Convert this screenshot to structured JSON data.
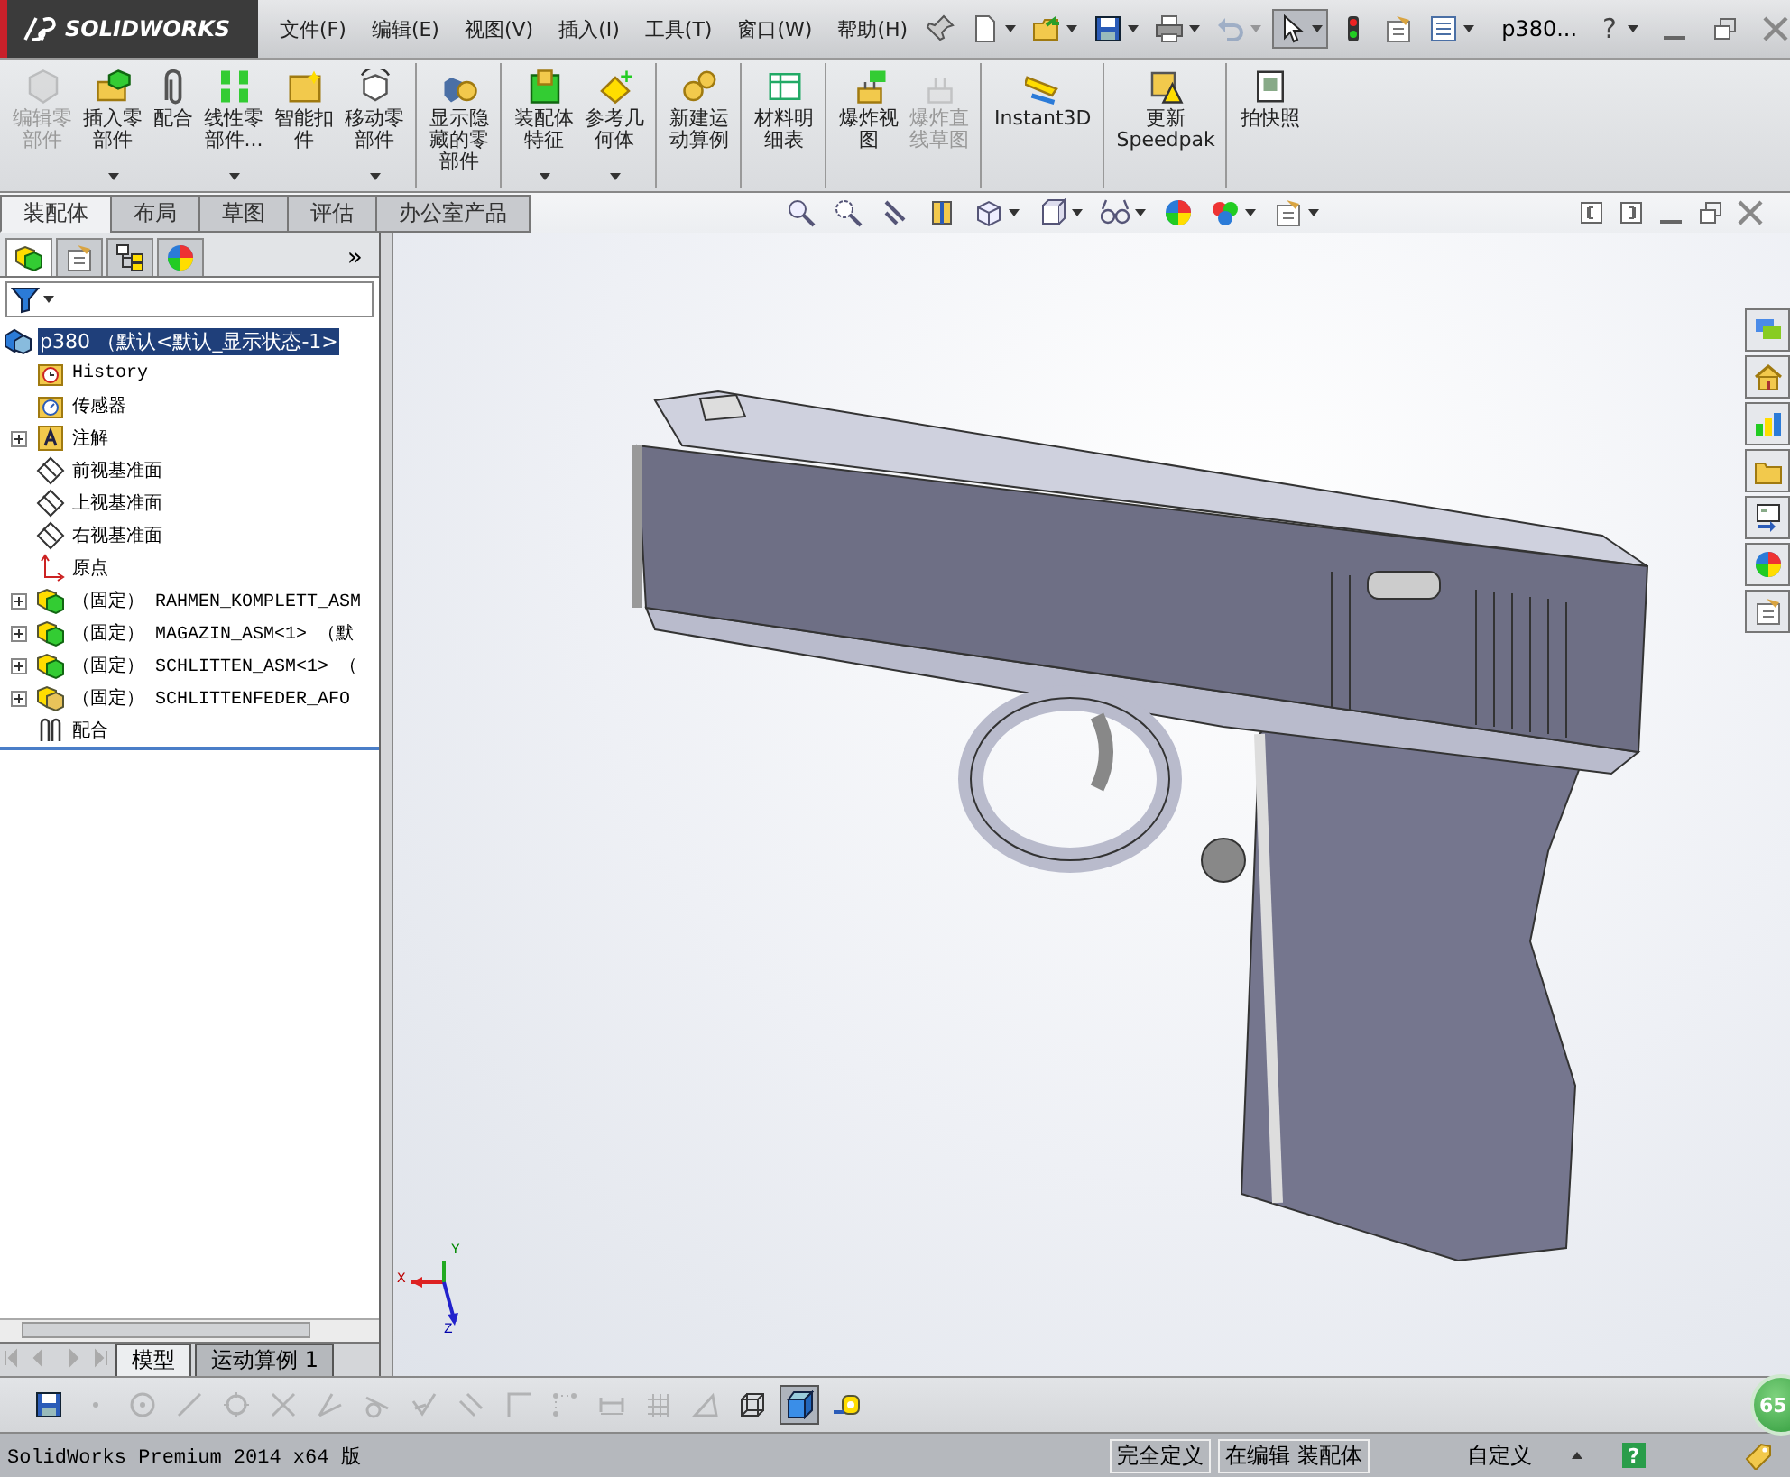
{
  "title_bar": {
    "logo": "SOLIDWORKS",
    "menus": [
      "文件(F)",
      "编辑(E)",
      "视图(V)",
      "插入(I)",
      "工具(T)",
      "窗口(W)",
      "帮助(H)"
    ],
    "document": "p380...",
    "help": "?"
  },
  "quick_toolbar": [
    {
      "kind": "new",
      "disabled": false,
      "selected": false,
      "dropdown": true
    },
    {
      "kind": "open",
      "disabled": false,
      "selected": false,
      "dropdown": true
    },
    {
      "kind": "save",
      "disabled": false,
      "selected": false,
      "dropdown": true
    },
    {
      "kind": "print",
      "disabled": false,
      "selected": false,
      "dropdown": true
    },
    {
      "kind": "undo",
      "disabled": true,
      "selected": false,
      "dropdown": true
    },
    {
      "kind": "select",
      "disabled": false,
      "selected": true,
      "dropdown": true
    },
    {
      "kind": "rebuild",
      "disabled": false,
      "selected": false,
      "dropdown": false
    },
    {
      "kind": "options",
      "disabled": false,
      "selected": false,
      "dropdown": false
    },
    {
      "kind": "list",
      "disabled": false,
      "selected": false,
      "dropdown": true
    }
  ],
  "ribbon": [
    {
      "kind": "edit-part",
      "lines": [
        "编辑零",
        "部件"
      ],
      "disabled": true,
      "dropdown": false,
      "separator_after": false
    },
    {
      "kind": "insert",
      "lines": [
        "插入零",
        "部件"
      ],
      "disabled": false,
      "dropdown": true,
      "separator_after": false
    },
    {
      "kind": "mate",
      "lines": [
        "配合"
      ],
      "disabled": false,
      "dropdown": false,
      "separator_after": false
    },
    {
      "kind": "pattern",
      "lines": [
        "线性零",
        "部件..."
      ],
      "disabled": false,
      "dropdown": true,
      "separator_after": false
    },
    {
      "kind": "fastener",
      "lines": [
        "智能扣",
        "件"
      ],
      "disabled": false,
      "dropdown": false,
      "separator_after": false
    },
    {
      "kind": "move",
      "lines": [
        "移动零",
        "部件"
      ],
      "disabled": false,
      "dropdown": true,
      "separator_after": true
    },
    {
      "kind": "show-hidden",
      "lines": [
        "显示隐",
        "藏的零",
        "部件"
      ],
      "disabled": false,
      "dropdown": false,
      "separator_after": true
    },
    {
      "kind": "feature",
      "lines": [
        "装配体",
        "特征"
      ],
      "disabled": false,
      "dropdown": true,
      "separator_after": false
    },
    {
      "kind": "ref-geometry",
      "lines": [
        "参考几",
        "何体"
      ],
      "disabled": false,
      "dropdown": true,
      "separator_after": true
    },
    {
      "kind": "motion",
      "lines": [
        "新建运",
        "动算例"
      ],
      "disabled": false,
      "dropdown": false,
      "separator_after": true
    },
    {
      "kind": "bom",
      "lines": [
        "材料明",
        "细表"
      ],
      "disabled": false,
      "dropdown": false,
      "separator_after": true
    },
    {
      "kind": "explode",
      "lines": [
        "爆炸视",
        "图"
      ],
      "disabled": false,
      "dropdown": false,
      "separator_after": false
    },
    {
      "kind": "explode-sketch",
      "lines": [
        "爆炸直",
        "线草图"
      ],
      "disabled": true,
      "dropdown": false,
      "separator_after": true
    },
    {
      "kind": "instant3d",
      "lines": [
        "Instant3D"
      ],
      "disabled": false,
      "dropdown": false,
      "separator_after": true
    },
    {
      "kind": "speedpak",
      "lines": [
        "更新",
        "Speedpak"
      ],
      "disabled": false,
      "dropdown": false,
      "separator_after": true
    },
    {
      "kind": "snapshot",
      "lines": [
        "拍快照"
      ],
      "disabled": false,
      "dropdown": false,
      "separator_after": false
    }
  ],
  "command_tabs": [
    {
      "label": "装配体",
      "selected": true
    },
    {
      "label": "布局",
      "selected": false
    },
    {
      "label": "草图",
      "selected": false
    },
    {
      "label": "评估",
      "selected": false
    },
    {
      "label": "办公室产品",
      "selected": false
    }
  ],
  "heads_up_toolbar": [
    {
      "kind": "zoom-fit",
      "dropdown": false
    },
    {
      "kind": "zoom-area",
      "dropdown": false
    },
    {
      "kind": "prev-view",
      "dropdown": false
    },
    {
      "kind": "section",
      "dropdown": false
    },
    {
      "kind": "view-orient",
      "dropdown": true
    },
    {
      "kind": "display-style",
      "dropdown": true
    },
    {
      "kind": "hide-show",
      "dropdown": true
    },
    {
      "kind": "appearance",
      "dropdown": false
    },
    {
      "kind": "scene",
      "dropdown": true
    },
    {
      "kind": "view-settings",
      "dropdown": true
    }
  ],
  "feature_manager": {
    "panel_tabs": [
      {
        "kind": "feature-tree",
        "selected": true
      },
      {
        "kind": "property",
        "selected": false
      },
      {
        "kind": "config",
        "selected": false
      },
      {
        "kind": "display",
        "selected": false
      }
    ],
    "more": "»",
    "tree": [
      {
        "label": "p380 （默认<默认_显示状态-1>",
        "kind": "assembly",
        "selected": true,
        "children": [
          {
            "label": "History",
            "kind": "history",
            "selected": false
          },
          {
            "label": "传感器",
            "kind": "sensor",
            "selected": false
          },
          {
            "label": "注解",
            "kind": "annotation",
            "selected": false,
            "expanded": false
          },
          {
            "label": "前视基准面",
            "kind": "plane",
            "selected": false
          },
          {
            "label": "上视基准面",
            "kind": "plane",
            "selected": false
          },
          {
            "label": "右视基准面",
            "kind": "plane",
            "selected": false
          },
          {
            "label": "原点",
            "kind": "origin",
            "selected": false
          },
          {
            "label": "（固定） RAHMEN_KOMPLETT_ASM",
            "kind": "subassembly",
            "selected": false,
            "expanded": false
          },
          {
            "label": "（固定） MAGAZIN_ASM<1> （默",
            "kind": "subassembly",
            "selected": false,
            "expanded": false
          },
          {
            "label": "（固定） SCHLITTEN_ASM<1> （",
            "kind": "subassembly",
            "selected": false,
            "expanded": false
          },
          {
            "label": "（固定） SCHLITTENFEDER_AFO",
            "kind": "part",
            "selected": false,
            "expanded": false
          },
          {
            "label": "配合",
            "kind": "mates",
            "selected": false
          }
        ]
      }
    ]
  },
  "bottom_tabs": [
    {
      "label": "模型",
      "selected": true
    },
    {
      "label": "运动算例 1",
      "selected": false
    }
  ],
  "viewport": {
    "triad": {
      "x": "X",
      "y": "Y",
      "z": "Z"
    },
    "badge": "65"
  },
  "sketch_toolbar": [
    {
      "kind": "save",
      "disabled": false,
      "selected": false
    },
    {
      "kind": "point",
      "disabled": true,
      "selected": false
    },
    {
      "kind": "circle",
      "disabled": true,
      "selected": false
    },
    {
      "kind": "line",
      "disabled": true,
      "selected": false
    },
    {
      "kind": "polygon",
      "disabled": true,
      "selected": false
    },
    {
      "kind": "trim",
      "disabled": true,
      "selected": false
    },
    {
      "kind": "angle",
      "disabled": true,
      "selected": false
    },
    {
      "kind": "tangent",
      "disabled": true,
      "selected": false
    },
    {
      "kind": "check",
      "disabled": true,
      "selected": false
    },
    {
      "kind": "parallel",
      "disabled": true,
      "selected": false
    },
    {
      "kind": "corner",
      "disabled": true,
      "selected": false
    },
    {
      "kind": "dots",
      "disabled": true,
      "selected": false
    },
    {
      "kind": "dimension",
      "disabled": true,
      "selected": false
    },
    {
      "kind": "grid",
      "disabled": true,
      "selected": false
    },
    {
      "kind": "triangle",
      "disabled": true,
      "selected": false
    },
    {
      "kind": "wire-cube",
      "disabled": false,
      "selected": false
    },
    {
      "kind": "shaded-cube",
      "disabled": false,
      "selected": true
    },
    {
      "kind": "tape",
      "disabled": false,
      "selected": false
    }
  ],
  "status_bar": {
    "text": "SolidWorks Premium 2014 x64 版",
    "cells": [
      "完全定义",
      "在编辑 装配体"
    ],
    "custom": "自定义",
    "help": "?"
  }
}
